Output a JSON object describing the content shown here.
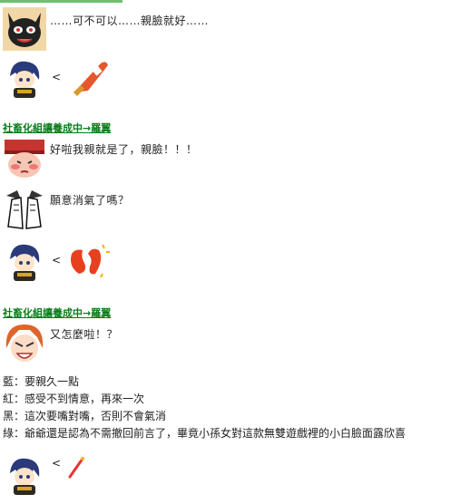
{
  "thread": {
    "header_link": "社畜化組讓養成中→羅翼",
    "posts": [
      {
        "avatar": "black-cat-avatar",
        "text": "……可不可以……親臉就好……"
      },
      {
        "avatar": "blue-hair-chibi-avatar",
        "text": "<",
        "sticker": "kiss-lips-sticker"
      },
      {
        "avatar": "blushing-red-hat-avatar",
        "text": "好啦我親就是了，親臉！！！"
      },
      {
        "avatar": "face-palm-manga-avatar",
        "text": "願意消氣了嗎？"
      },
      {
        "avatar": "blue-hair-chibi-avatar",
        "text": "<",
        "sticker": "red-lips-sticker"
      },
      {
        "avatar": "red-hair-angry-avatar",
        "text": "又怎麼啦！？"
      },
      {
        "avatar": "blue-hair-chibi-avatar",
        "text": "<",
        "sticker": "red-pin-sticker"
      }
    ],
    "dialogue": [
      "藍：要親久一點",
      "紅：感受不到情意，再來一次",
      "黑：這次要嘴對嘴，否則不會氣消",
      "綠：爺爺還是認為不需撤回前言了，畢竟小孫女對這款無雙遊戲裡的小白臉面露欣喜"
    ]
  },
  "colors": {
    "link": "#0a7d1a",
    "accent_green": "#6fbf6f"
  }
}
